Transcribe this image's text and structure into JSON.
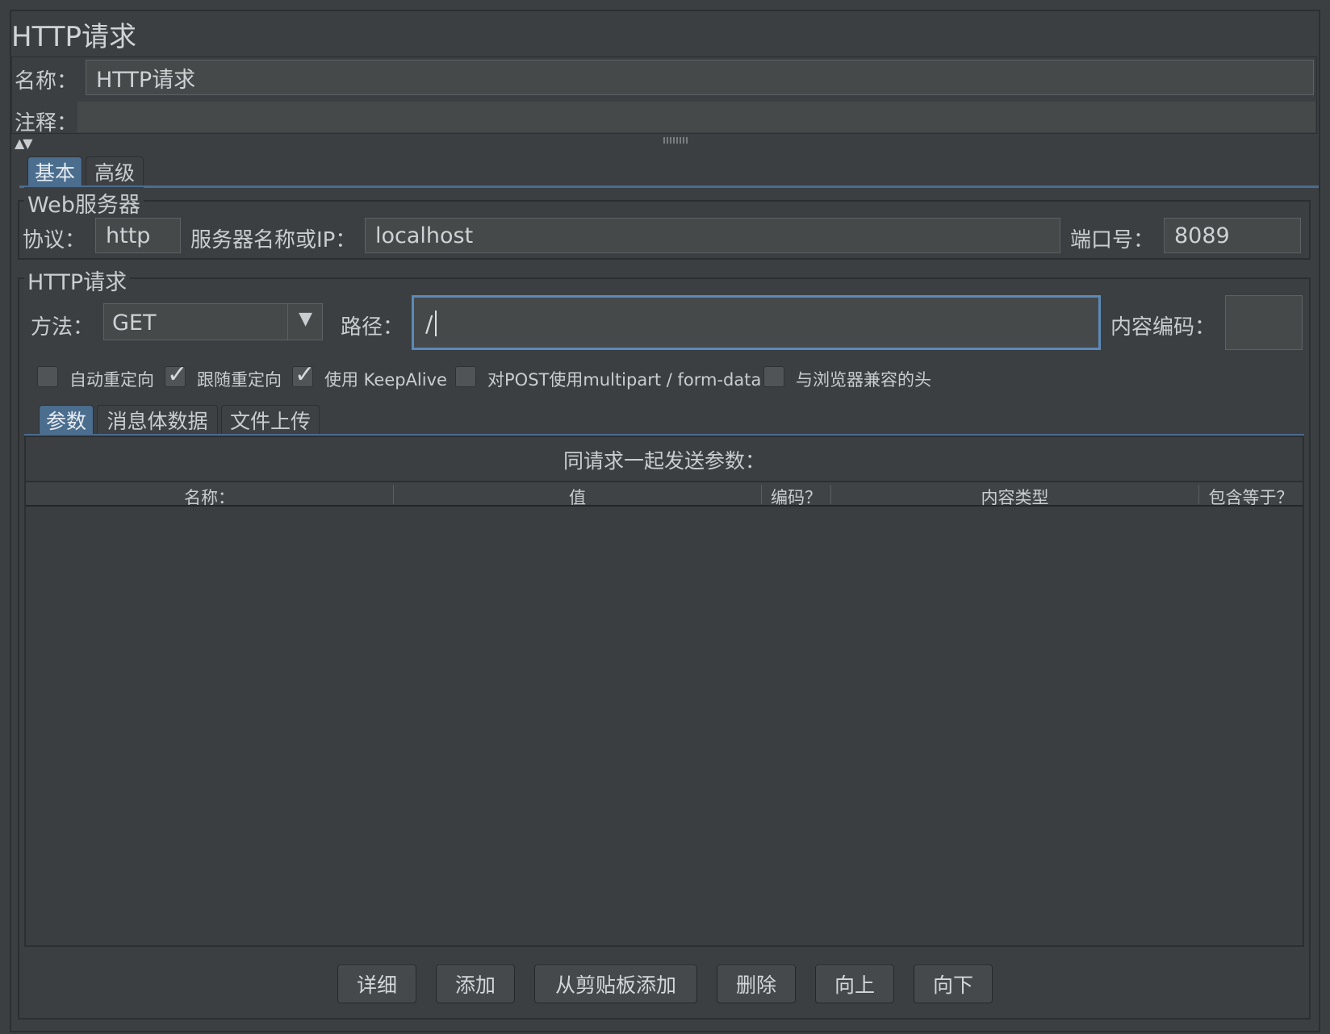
{
  "title": "HTTP请求",
  "name_label": "名称：",
  "name_value": "HTTP请求",
  "comment_label": "注释：",
  "comment_value": "",
  "collapse_arrows": "▲▼",
  "tabs_top": [
    {
      "label": "基本",
      "selected": true
    },
    {
      "label": "高级",
      "selected": false
    }
  ],
  "web_server": {
    "title": "Web服务器",
    "protocol_label": "协议：",
    "protocol_value": "http",
    "server_label": "服务器名称或IP：",
    "server_value": "localhost",
    "port_label": "端口号：",
    "port_value": "8089"
  },
  "http_request": {
    "title": "HTTP请求",
    "method_label": "方法：",
    "method_value": "GET",
    "path_label": "路径：",
    "path_value": "/",
    "encoding_label": "内容编码：",
    "encoding_value": ""
  },
  "checkboxes": [
    {
      "label": "自动重定向",
      "checked": false
    },
    {
      "label": "跟随重定向",
      "checked": true
    },
    {
      "label": "使用 KeepAlive",
      "checked": true
    },
    {
      "label": "对POST使用multipart / form-data",
      "checked": false
    },
    {
      "label": "与浏览器兼容的头",
      "checked": false
    }
  ],
  "tabs_sub": [
    {
      "label": "参数",
      "selected": true
    },
    {
      "label": "消息体数据",
      "selected": false
    },
    {
      "label": "文件上传",
      "selected": false
    }
  ],
  "params": {
    "caption": "同请求一起发送参数：",
    "columns": [
      "名称：",
      "值",
      "编码？",
      "内容类型",
      "包含等于？"
    ]
  },
  "buttons": [
    "详细",
    "添加",
    "从剪贴板添加",
    "删除",
    "向上",
    "向下"
  ],
  "colors": {
    "background": "#3b3f42",
    "selected_tab": "#4b6d8e",
    "focus_border": "#5b8ab8"
  }
}
